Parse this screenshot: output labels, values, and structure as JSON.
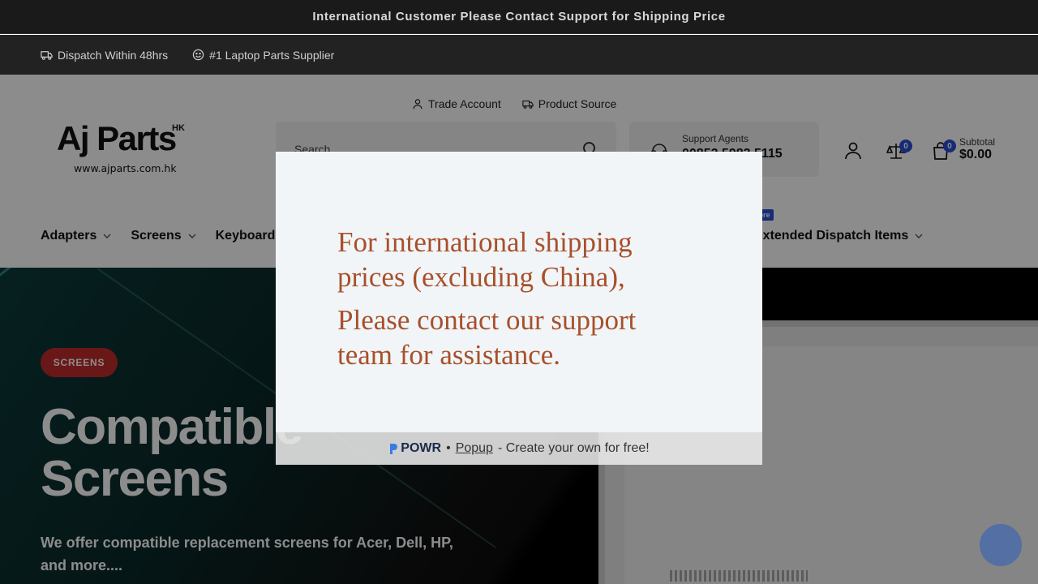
{
  "announcement": "International Customer Please Contact Support for Shipping Price",
  "infobar": {
    "dispatch": "Dispatch Within 48hrs",
    "supplier": "#1 Laptop Parts Supplier"
  },
  "toplinks": {
    "trade": "Trade Account",
    "source": "Product Source"
  },
  "logo": {
    "text": "Aj Parts",
    "region": "HK",
    "url": "www.ajparts.com.hk"
  },
  "search": {
    "placeholder": "Search"
  },
  "support": {
    "label": "Support Agents",
    "number": "00852 5983 5115"
  },
  "header": {
    "compare_count": "0",
    "cart_count": "0",
    "subtotal_label": "Subtotal",
    "subtotal_value": "$0.00"
  },
  "nav": {
    "items": [
      "Adapters",
      "Screens",
      "Keyboards"
    ],
    "right_item": "Extended Dispatch Items",
    "new_badge": "More"
  },
  "hero": {
    "tag": "SCREENS",
    "title_line1": "Compatible",
    "title_line2": "Screens",
    "subtitle": "We offer compatible replacement screens for Acer, Dell, HP, and more...."
  },
  "modal": {
    "line1": "For international shipping prices (excluding China),",
    "line2": "Please contact our support team for assistance.",
    "powr_brand": "POWR",
    "powr_link": "Popup",
    "powr_tail": "- Create your own for free!"
  }
}
